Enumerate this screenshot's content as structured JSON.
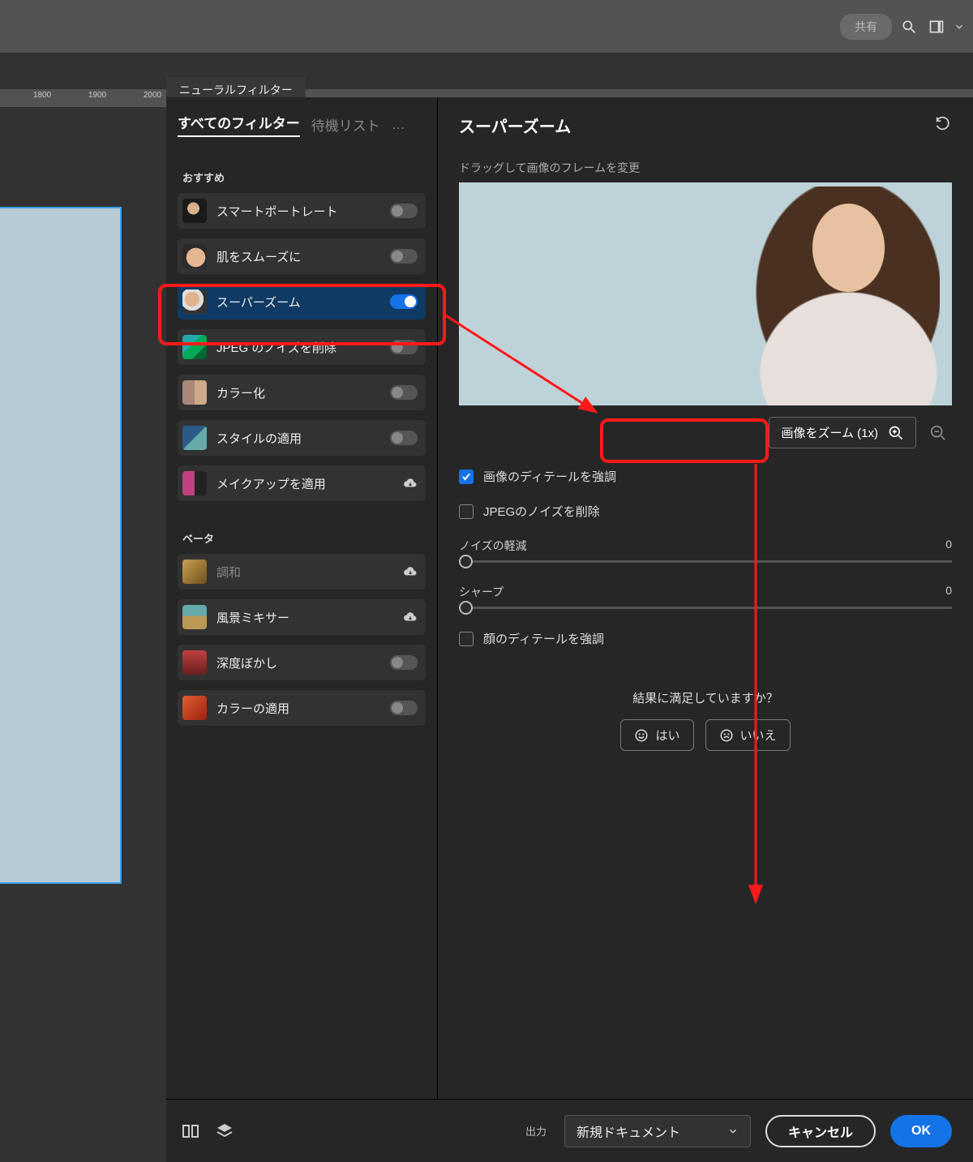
{
  "topbar": {
    "share": "共有"
  },
  "ruler": {
    "t1": "1800",
    "t2": "1900",
    "t3": "2000"
  },
  "panel_tab": "ニューラルフィルター",
  "tabs": {
    "all": "すべてのフィルター",
    "wait": "待機リスト",
    "more": "…"
  },
  "sections": {
    "recommended": "おすすめ",
    "beta": "ベータ"
  },
  "filters": {
    "portrait": "スマートポートレート",
    "skin": "肌をスムーズに",
    "zoom": "スーパーズーム",
    "jpeg": "JPEG のノイズを削除",
    "colorize": "カラー化",
    "style": "スタイルの適用",
    "makeup": "メイクアップを適用",
    "harmony": "調和",
    "landscape": "風景ミキサー",
    "depth": "深度ぼかし",
    "colorapply": "カラーの適用"
  },
  "detail": {
    "title": "スーパーズーム",
    "drag_hint": "ドラッグして画像のフレームを変更",
    "zoom_btn": "画像をズーム (1x)",
    "cb_detail": "画像のディテールを強調",
    "cb_jpeg": "JPEGのノイズを削除",
    "sl_noise": "ノイズの軽減",
    "sl_noise_val": "0",
    "sl_sharp": "シャープ",
    "sl_sharp_val": "0",
    "cb_face": "顔のディテールを強調",
    "sat_q": "結果に満足していますか？",
    "yes": "はい",
    "no": "いいえ"
  },
  "bottom": {
    "output_label": "出力",
    "output_value": "新規ドキュメント",
    "cancel": "キャンセル",
    "ok": "OK"
  }
}
